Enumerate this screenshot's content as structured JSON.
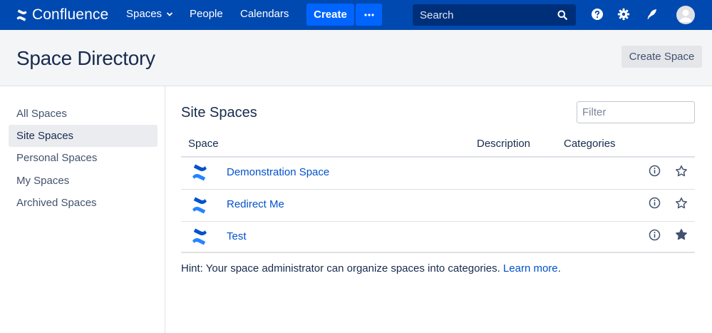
{
  "nav": {
    "brand": "Confluence",
    "spaces_label": "Spaces",
    "people_label": "People",
    "calendars_label": "Calendars",
    "create_label": "Create",
    "more_label": "•••",
    "search_placeholder": "Search",
    "brand_color": "#0049b0",
    "accent_color": "#0065ff",
    "icons": [
      "help-icon",
      "settings-icon",
      "notifications-icon",
      "avatar"
    ]
  },
  "header": {
    "title": "Space Directory",
    "create_space_label": "Create Space"
  },
  "sidebar": {
    "items": [
      {
        "label": "All Spaces",
        "active": false
      },
      {
        "label": "Site Spaces",
        "active": true
      },
      {
        "label": "Personal Spaces",
        "active": false
      },
      {
        "label": "My Spaces",
        "active": false
      },
      {
        "label": "Archived Spaces",
        "active": false
      }
    ]
  },
  "main": {
    "title": "Site Spaces",
    "filter_placeholder": "Filter",
    "columns": {
      "space": "Space",
      "description": "Description",
      "categories": "Categories"
    },
    "rows": [
      {
        "name": "Demonstration Space",
        "starred": false
      },
      {
        "name": "Redirect Me",
        "starred": false
      },
      {
        "name": "Test",
        "starred": true
      }
    ],
    "hint_text": "Hint: Your space administrator can organize spaces into categories. ",
    "hint_link": "Learn more",
    "hint_end": "."
  }
}
